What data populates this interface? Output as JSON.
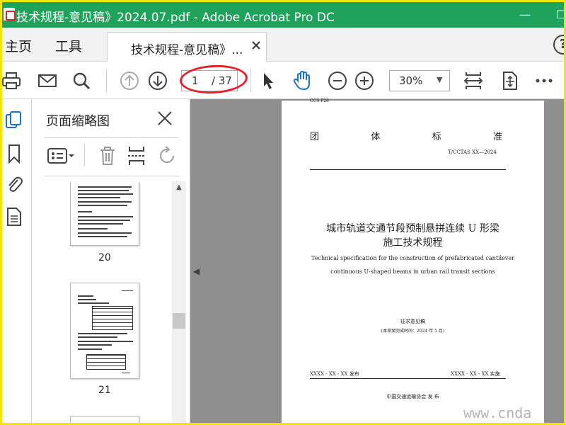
{
  "window": {
    "title": "技术规程-意见稿》2024.07.pdf - Adobe Acrobat Pro DC",
    "minimize": "—",
    "maximize": "☐",
    "accent": "#1fa35c",
    "frame_color": "#f2e600"
  },
  "menu": {
    "home": "主页",
    "tools": "工具",
    "doc_tab": "技术规程-意见稿》...",
    "tab_close": "close-icon",
    "help": "?"
  },
  "toolbar": {
    "icons": [
      "print-icon",
      "email-icon",
      "search-icon",
      "prev-page-icon",
      "next-page-icon",
      "select-arrow-icon",
      "hand-tool-icon",
      "zoom-out-icon",
      "zoom-in-icon",
      "fit-page-icon",
      "scrolling-mode-icon",
      "more-icon"
    ],
    "page_current": "1",
    "page_total": "/ 37",
    "zoom": "30%",
    "highlight_color": "#e2252b"
  },
  "sidebar": {
    "panel_title": "页面缩略图",
    "thumbnails": [
      {
        "page": "20"
      },
      {
        "page": "21"
      }
    ]
  },
  "document": {
    "ccs": "CCS  P28",
    "org_chars": [
      "团",
      "体",
      "标",
      "准"
    ],
    "code": "T/CCTAS  XX—2024",
    "title_cn_line1": "城市轨道交通节段预制悬拼连续 U 形梁",
    "title_cn_line2": "施工技术规程",
    "title_en_line1": "Technical specification for the construction of prefabricated cantilever",
    "title_en_line2": "continuous U-shaped beams in urban rail transit sections",
    "draft_status": "征求意见稿",
    "draft_date": "(本草案完成时间：2024 年 5 月)",
    "publish": "XXXX - XX - XX 发布",
    "implement": "XXXX - XX - XX 实施",
    "issuer": "中国交通运输协会    发  布"
  },
  "watermark": "www.cnda"
}
